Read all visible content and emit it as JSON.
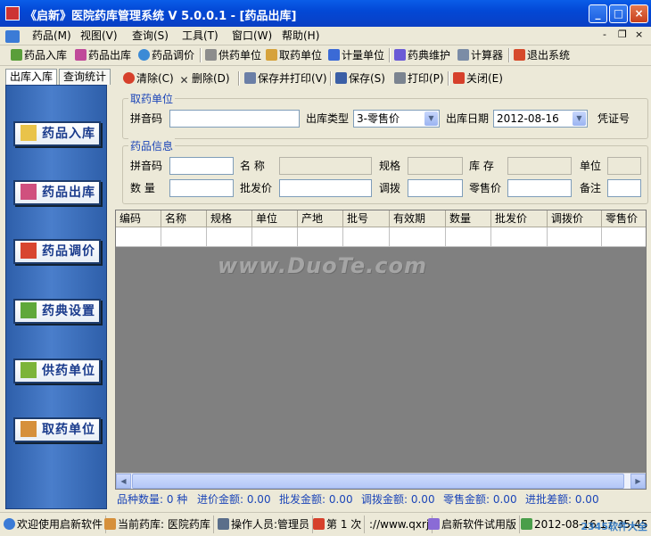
{
  "window": {
    "title": "《启新》医院药库管理系统 V 5.0.0.1 - [药品出库]",
    "controls": [
      "_",
      "□",
      "×"
    ]
  },
  "menubar": {
    "items": [
      "药品(M)",
      "视图(V)",
      "查询(S)",
      "工具(T)",
      "窗口(W)",
      "帮助(H)"
    ],
    "mdi": [
      "-",
      "❐",
      "×"
    ]
  },
  "toolbar": {
    "items": [
      "药品入库",
      "药品出库",
      "药品调价",
      "供药单位",
      "取药单位",
      "计量单位",
      "药典维护",
      "计算器",
      "退出系统"
    ]
  },
  "left": {
    "tabs": [
      "出库入库",
      "查询统计"
    ],
    "nav": [
      "药品入库",
      "药品出库",
      "药品调价",
      "药典设置",
      "供药单位",
      "取药单位"
    ]
  },
  "actions": [
    "清除(C)",
    "删除(D)",
    "保存并打印(V)",
    "保存(S)",
    "打印(P)",
    "关闭(E)"
  ],
  "section1": {
    "legend": "取药单位",
    "pinyin_label": "拼音码",
    "pinyin_value": "",
    "type_label": "出库类型",
    "type_value": "3-零售价",
    "date_label": "出库日期",
    "date_value": "2012-08-16",
    "voucher_label": "凭证号"
  },
  "section2": {
    "legend": "药品信息",
    "labels": {
      "pinyin": "拼音码",
      "name": "名 称",
      "spec": "规格",
      "stock": "库 存",
      "unit": "单位",
      "qty": "数 量",
      "wholesale": "批发价",
      "transfer": "调拨",
      "retail": "零售价",
      "remark": "备注"
    }
  },
  "grid": {
    "columns": [
      "编码",
      "名称",
      "规格",
      "单位",
      "产地",
      "批号",
      "有效期",
      "数量",
      "批发价",
      "调拨价",
      "零售价"
    ]
  },
  "summary": [
    "品种数量: 0 种",
    "进价金额: 0.00",
    "批发金额: 0.00",
    "调拨金额: 0.00",
    "零售金额: 0.00",
    "进批差额: 0.00"
  ],
  "status": [
    "欢迎使用启新软件",
    "当前药库: 医院药库",
    "操作人员:管理员",
    "第 1 次",
    "://www.qxrj",
    "启新软件试用版",
    "2012-08-16 17:35:45"
  ],
  "watermark": "www.DuoTe.com",
  "brand": "2345软件大全",
  "colors": {
    "titlebar": "#0348d6",
    "leftpanel": "#3a6cb9",
    "grid_bg": "#808080",
    "summary_text": "#1b45b8"
  }
}
